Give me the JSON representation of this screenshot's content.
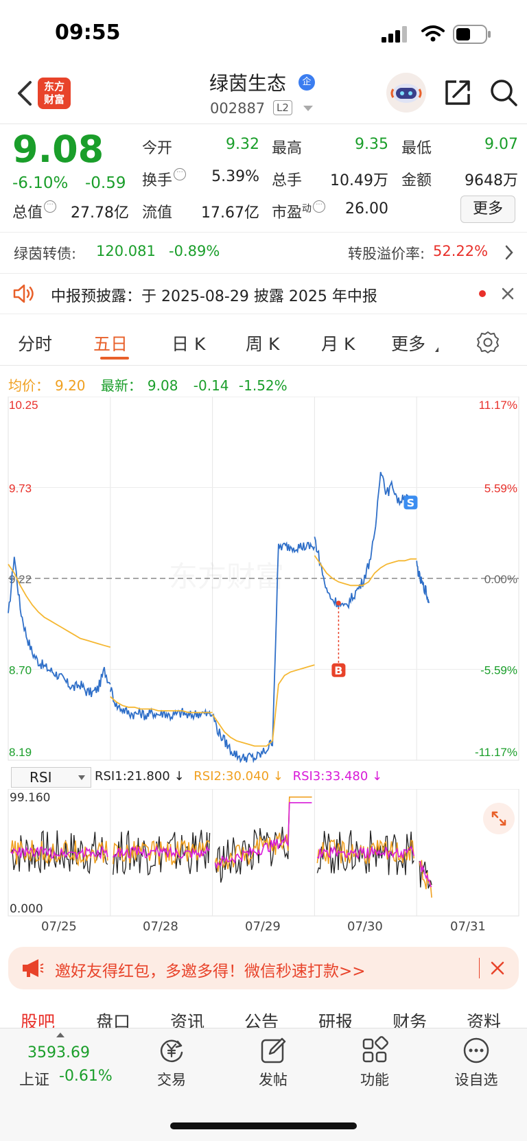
{
  "status_bar": {
    "time": "09:55"
  },
  "header": {
    "logo_line1": "东方",
    "logo_line2": "财富",
    "stock_name": "绿茵生态",
    "corp_badge": "企",
    "stock_code": "002887",
    "level_badge": "L2",
    "icons": [
      "back-icon",
      "robot-avatar-icon",
      "share-icon",
      "search-icon"
    ]
  },
  "quote": {
    "price": "9.08",
    "change_pct": "-6.10%",
    "change": "-0.59",
    "fields": [
      {
        "label": "今开",
        "value": "9.32",
        "color": "#1a9e2a"
      },
      {
        "label": "最高",
        "value": "9.35",
        "color": "#1a9e2a"
      },
      {
        "label": "最低",
        "value": "9.07",
        "color": "#1a9e2a"
      },
      {
        "label": "换手",
        "value": "5.39%",
        "color": "#222222"
      },
      {
        "label": "总手",
        "value": "10.49万",
        "color": "#222222"
      },
      {
        "label": "金额",
        "value": "9648万",
        "color": "#222222"
      },
      {
        "label": "总值",
        "value": "27.78亿",
        "color": "#222222"
      },
      {
        "label": "流值",
        "value": "17.67亿",
        "color": "#222222"
      },
      {
        "label": "市盈",
        "superscript": "动",
        "value": "26.00",
        "color": "#222222"
      }
    ],
    "more_button": "更多"
  },
  "bond": {
    "label": "绿茵转债:",
    "price": "120.081",
    "change_pct": "-0.89%",
    "premium_label": "转股溢价率:",
    "premium_value": "52.22%"
  },
  "announcement": {
    "text": "中报预披露：于 2025-08-29 披露 2025 年中报"
  },
  "tabs": {
    "items": [
      "分时",
      "五日",
      "日 K",
      "周 K",
      "月 K",
      "更多"
    ],
    "active": "五日"
  },
  "chart_legend": {
    "avg_label": "均价：",
    "avg_value": "9.20",
    "latest_label": "最新：",
    "latest_value": "9.08",
    "latest_change": "-0.14",
    "latest_pct": "-1.52%"
  },
  "chart_data": {
    "type": "line",
    "price_axis_left": [
      "10.25",
      "9.73",
      "9.22",
      "8.70",
      "8.19"
    ],
    "pct_axis_right": [
      "11.17%",
      "5.59%",
      "0.00%",
      "-5.59%",
      "-11.17%"
    ],
    "ylim": [
      8.19,
      10.25
    ],
    "reference_price": 9.22,
    "dates": [
      "07/25",
      "07/28",
      "07/29",
      "07/30",
      "07/31"
    ],
    "series": [
      {
        "name": "price",
        "color": "#2f6fc8",
        "days": [
          [
            9.0,
            9.35,
            9.05,
            8.9,
            8.8,
            8.75,
            8.72,
            8.7,
            8.68,
            8.65,
            8.62,
            8.6,
            8.62,
            8.58,
            8.57,
            8.6,
            8.7,
            8.62
          ],
          [
            8.6,
            8.5,
            8.48,
            8.46,
            8.45,
            8.46,
            8.44,
            8.46,
            8.45,
            8.46,
            8.44,
            8.45,
            8.46,
            8.44,
            8.45,
            8.46,
            8.45,
            8.45
          ],
          [
            8.45,
            8.35,
            8.3,
            8.25,
            8.22,
            8.2,
            8.21,
            8.2,
            8.22,
            8.25,
            8.3,
            9.4,
            9.4,
            9.4,
            9.4,
            9.4,
            9.4,
            9.4
          ],
          [
            9.45,
            9.3,
            9.15,
            9.1,
            9.08,
            9.05,
            9.1,
            9.15,
            9.2,
            9.3,
            9.45,
            9.85,
            9.7,
            9.75,
            9.65,
            9.7,
            9.63,
            9.65
          ],
          [
            9.3,
            9.22,
            9.18,
            9.15,
            9.08
          ]
        ]
      },
      {
        "name": "avg",
        "color": "#f5b731",
        "days": [
          [
            9.3,
            9.25,
            9.18,
            9.12,
            9.07,
            9.03,
            9.0,
            8.98,
            8.96,
            8.94,
            8.92,
            8.9,
            8.88,
            8.87,
            8.86,
            8.85,
            8.84,
            8.83
          ],
          [
            8.55,
            8.52,
            8.5,
            8.49,
            8.49,
            8.48,
            8.48,
            8.48,
            8.47,
            8.47,
            8.47,
            8.47,
            8.47,
            8.46,
            8.46,
            8.46,
            8.46,
            8.46
          ],
          [
            8.45,
            8.4,
            8.35,
            8.32,
            8.3,
            8.29,
            8.28,
            8.27,
            8.27,
            8.27,
            8.3,
            8.62,
            8.67,
            8.69,
            8.7,
            8.71,
            8.72,
            8.73
          ],
          [
            9.35,
            9.3,
            9.25,
            9.22,
            9.2,
            9.19,
            9.18,
            9.18,
            9.18,
            9.2,
            9.25,
            9.28,
            9.3,
            9.31,
            9.32,
            9.32,
            9.33,
            9.33
          ]
        ]
      }
    ],
    "markers": [
      {
        "label": "B",
        "day": 3,
        "index": 4
      },
      {
        "label": "S",
        "day": 3,
        "index": 16
      }
    ]
  },
  "rsi": {
    "selector": "RSI",
    "rsi1": "RSI1:21.800 ↓",
    "rsi2": "RSI2:30.040 ↓",
    "rsi3": "RSI3:33.480 ↓",
    "axis_top": "99.160",
    "axis_bottom": "0.000"
  },
  "invite": {
    "text": "邀好友得红包，多邀多得！微信秒速打款>>"
  },
  "lower_tabs": [
    "股吧",
    "盘口",
    "资讯",
    "公告",
    "研报",
    "财务",
    "资料"
  ],
  "bottom_nav": {
    "index_value": "3593.69",
    "index_name": "上证",
    "index_change": "-0.61%",
    "items": [
      {
        "label": "交易",
        "icon": "yuan-refresh-icon"
      },
      {
        "label": "发帖",
        "icon": "edit-icon"
      },
      {
        "label": "功能",
        "icon": "grid-icon"
      },
      {
        "label": "设自选",
        "icon": "more-dots-icon"
      }
    ]
  },
  "colors": {
    "up": "#e8302a",
    "down": "#1a9e2a",
    "accent": "#e8602a",
    "price_line": "#2f6fc8",
    "avg_line": "#f5b731"
  }
}
